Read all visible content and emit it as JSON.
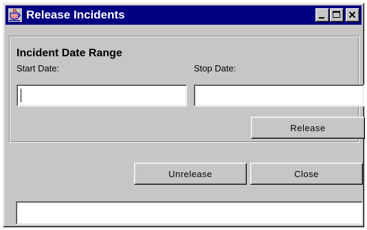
{
  "window": {
    "title": "Release Incidents",
    "app_icon": "java-cup-icon",
    "controls": [
      "minimize-icon",
      "maximize-icon",
      "close-icon"
    ]
  },
  "date_range": {
    "heading": "Incident Date Range",
    "start_label": "Start Date:",
    "start_value": "",
    "stop_label": "Stop Date:",
    "stop_value": "",
    "release_label": "Release"
  },
  "actions": {
    "unrelease_label": "Unrelease",
    "close_label": "Close"
  },
  "status": {
    "text": ""
  },
  "colors": {
    "titlebar": "#000080",
    "face": "#c6c6c6",
    "field": "#ffffff"
  }
}
